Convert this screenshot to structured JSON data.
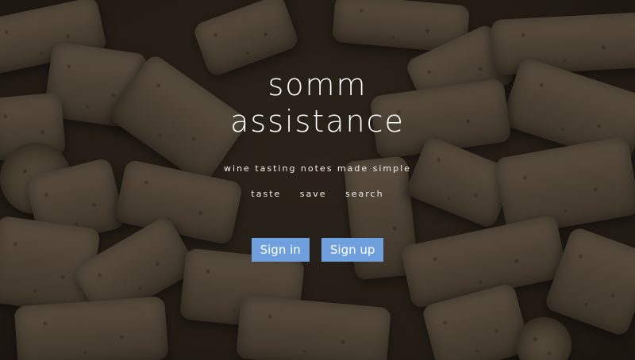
{
  "brand": {
    "title_line1": "somm",
    "title_line2": "assistance",
    "tagline": "wine tasting notes made simple"
  },
  "features": [
    "taste",
    "save",
    "search"
  ],
  "actions": {
    "sign_in": "Sign in",
    "sign_up": "Sign up"
  },
  "colors": {
    "button": "#6f9fdc",
    "text": "#ffffff"
  },
  "background": {
    "subject": "pile of used wine corks"
  }
}
